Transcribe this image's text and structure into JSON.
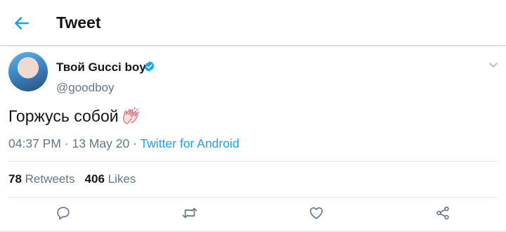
{
  "header": {
    "title": "Tweet",
    "back_icon": "arrow-left-icon",
    "accent": "#1da1f2"
  },
  "tweet": {
    "display_name": "Твой Gucci boy",
    "handle": "@goodboy",
    "verified": true,
    "text": "Горжусь собой",
    "emoji": "clapping-hands-icon",
    "time": "04:37 PM",
    "separator": " · ",
    "date": "13 May 20",
    "source": "Twitter for Android"
  },
  "stats": {
    "retweets_count": "78",
    "retweets_label": "Retweets",
    "likes_count": "406",
    "likes_label": "Likes"
  },
  "actions": [
    "reply-icon",
    "retweet-icon",
    "like-icon",
    "share-icon"
  ],
  "colors": {
    "text": "#14171a",
    "secondary": "#657786",
    "link": "#1da1f2",
    "divider": "#e1e8ed"
  }
}
